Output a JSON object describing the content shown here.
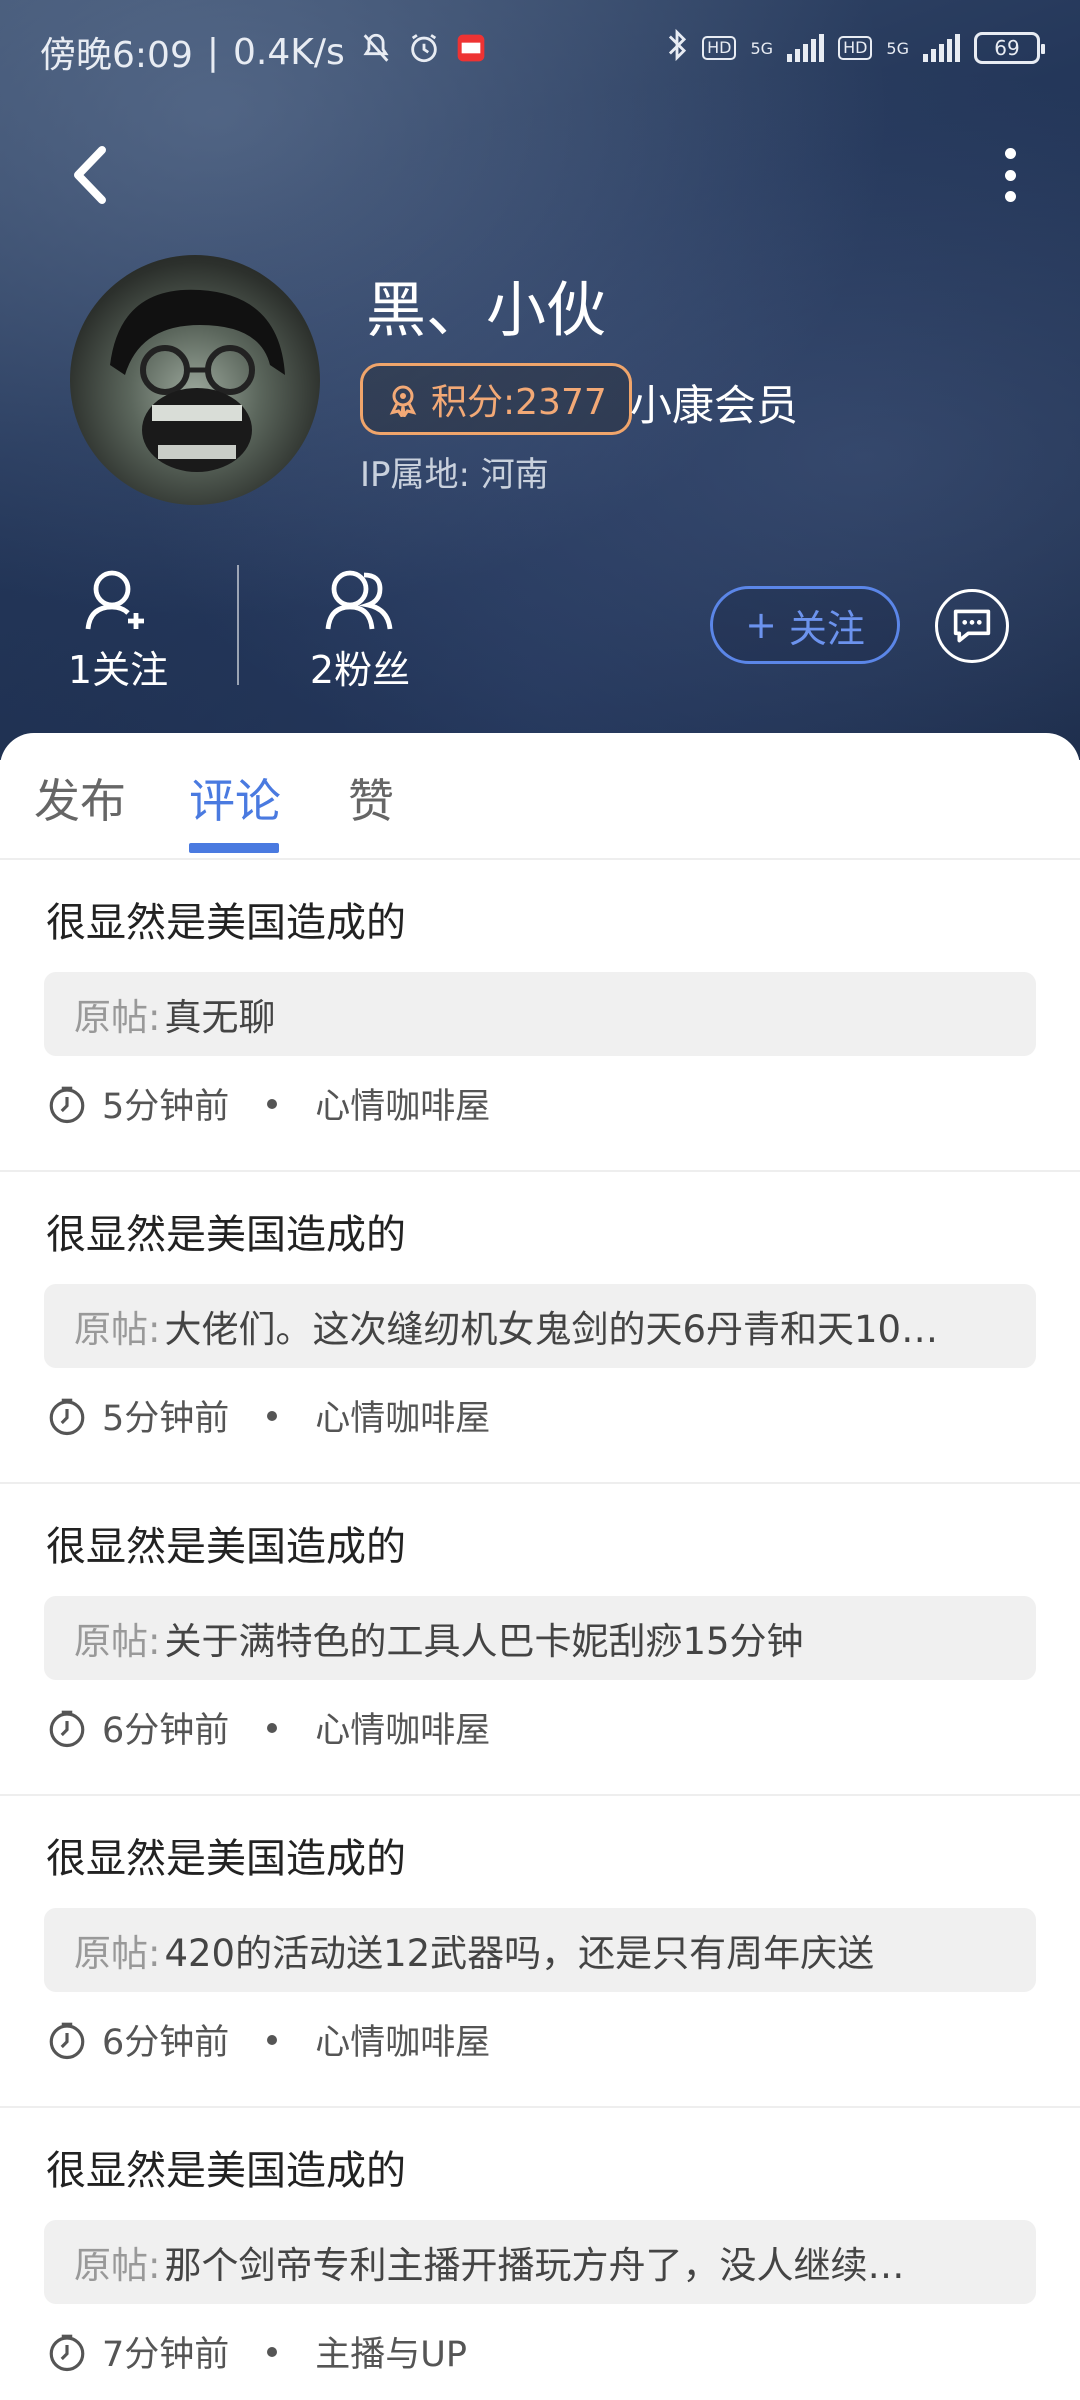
{
  "status_bar": {
    "time": "傍晚6:09",
    "speed": "0.4K/s",
    "hd1": "HD",
    "net1": "5G",
    "hd2": "HD",
    "net2": "5G",
    "battery": "69"
  },
  "profile": {
    "username": "黑、小伙",
    "points_label": "积分:2377",
    "member_label": "小康会员",
    "ip_label": "IP属地: 河南",
    "following_label": "1关注",
    "fans_label": "2粉丝",
    "follow_button_plus": "+",
    "follow_button_label": "关注"
  },
  "tabs": [
    {
      "label": "发布",
      "active": false
    },
    {
      "label": "评论",
      "active": true
    },
    {
      "label": "赞",
      "active": false
    }
  ],
  "comments": [
    {
      "title": "很显然是美国造成的",
      "orig_label": "原帖:",
      "orig_text": "真无聊",
      "time": "5分钟前",
      "board": "心情咖啡屋"
    },
    {
      "title": "很显然是美国造成的",
      "orig_label": "原帖:",
      "orig_text": "大佬们。这次缝纫机女鬼剑的天6丹青和天10…",
      "time": "5分钟前",
      "board": "心情咖啡屋"
    },
    {
      "title": "很显然是美国造成的",
      "orig_label": "原帖:",
      "orig_text": "关于满特色的工具人巴卡妮刮痧15分钟",
      "time": "6分钟前",
      "board": "心情咖啡屋"
    },
    {
      "title": "很显然是美国造成的",
      "orig_label": "原帖:",
      "orig_text": "420的活动送12武器吗，还是只有周年庆送",
      "time": "6分钟前",
      "board": "心情咖啡屋"
    },
    {
      "title": "很显然是美国造成的",
      "orig_label": "原帖:",
      "orig_text": "那个剑帝专利主播开播玩方舟了，没人继续…",
      "time": "7分钟前",
      "board": "主播与UP"
    }
  ],
  "colors": {
    "accent": "#4a7ae0",
    "points": "#f3a976"
  }
}
